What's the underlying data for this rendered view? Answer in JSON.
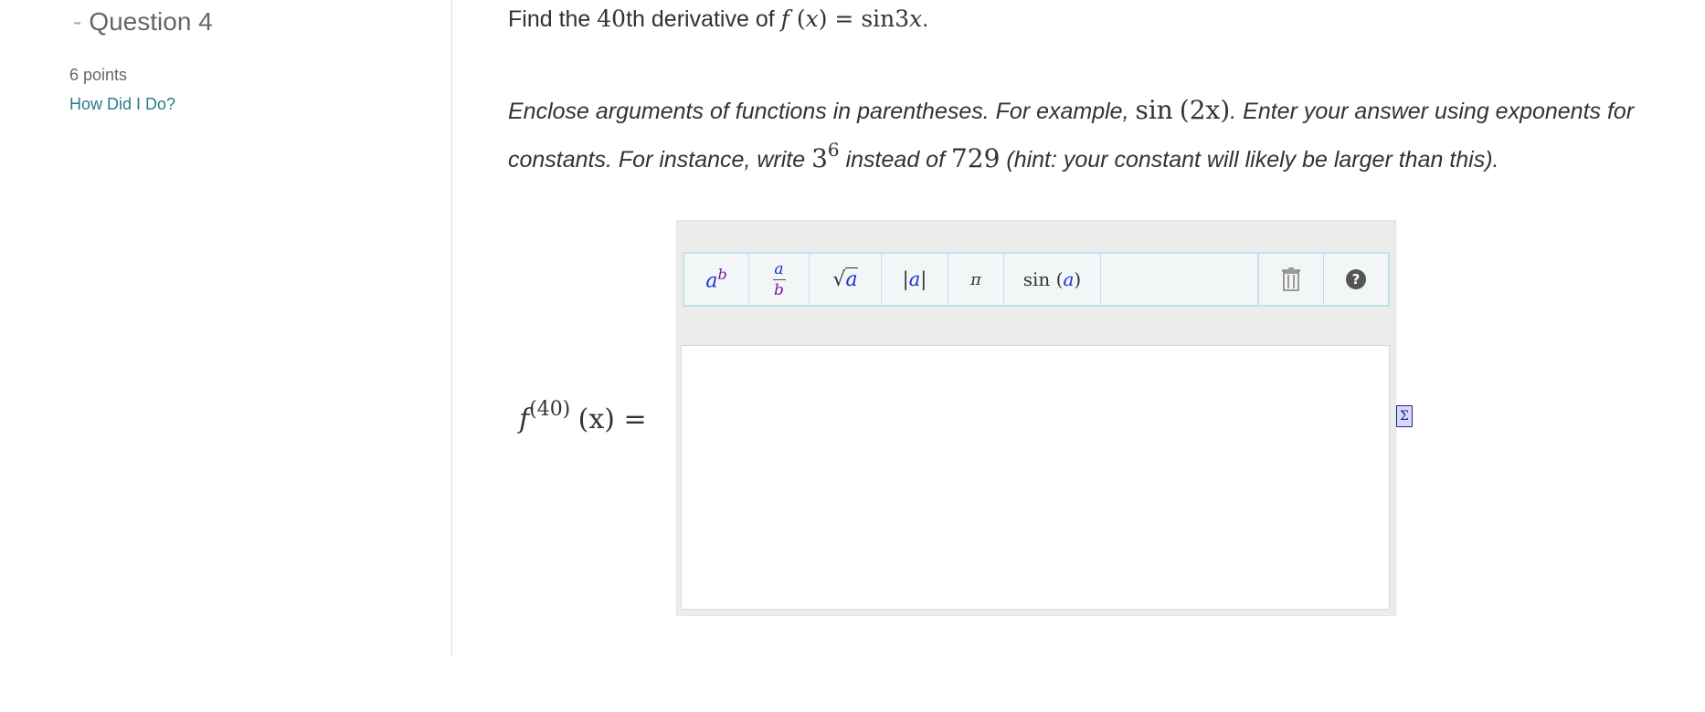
{
  "question": {
    "dash": "-",
    "title": "Question 4",
    "points": "6 points",
    "how_did_i_do": "How Did I Do?"
  },
  "prompt": {
    "prefix": "Find the ",
    "nth": "40",
    "mid": "th derivative of ",
    "fname": "f",
    "lparen": " (",
    "var": "x",
    "rparen": ")",
    "eq": " = ",
    "func": "sin3",
    "var2": "x",
    "period": "."
  },
  "instructions": {
    "part1": "Enclose arguments of functions in parentheses. For example, ",
    "example_func": "sin",
    "example_arg": "(2x)",
    "part2": ". Enter your answer using exponents for constants. For instance, write ",
    "base": "3",
    "exp": "6",
    "part3": " instead of ",
    "number": "729",
    "part4": " (hint: your constant will likely be larger than this)."
  },
  "toolbar": {
    "power_base": "a",
    "power_exp": "b",
    "frac_num": "a",
    "frac_den": "b",
    "sqrt_sym": "√",
    "sqrt_arg": "a",
    "abs_bar": "|",
    "abs_arg": "a",
    "pi": "π",
    "sin_fn": "sin",
    "sin_arg": "a",
    "trash_icon": "trash-icon",
    "help_icon": "question-circle-icon"
  },
  "answer_label": {
    "fname": "f",
    "order": "(40)",
    "arg": "(x)",
    "eq": " ="
  },
  "sigma_icon": "Σ",
  "colors": {
    "link": "#2a7a8c",
    "toolbar_border": "#bfe3ea",
    "math_blue": "#1a2fd8",
    "math_purple": "#7b1a9e"
  }
}
